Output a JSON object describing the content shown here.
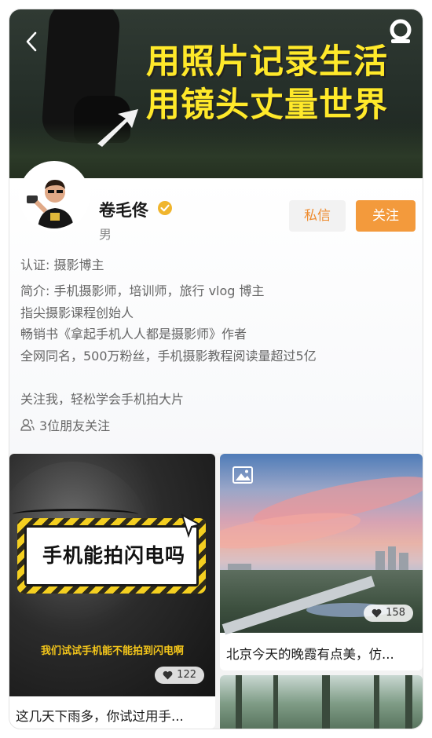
{
  "cover": {
    "headline_line1": "用照片记录生活",
    "headline_line2": "用镜头丈量世界"
  },
  "profile": {
    "name": "卷毛佟",
    "gender": "男",
    "message_label": "私信",
    "follow_label": "关注",
    "certification": "认证: 摄影博主",
    "bio_lines": [
      "简介: 手机摄影师，培训师，旅行 vlog 博主",
      "指尖摄影课程创始人",
      "畅销书《拿起手机人人都是摄影师》作者",
      "全网同名，500万粉丝，手机摄影教程阅读量超过5亿",
      "关注我，轻松学会手机拍大片"
    ],
    "friends_following": "3位朋友关注"
  },
  "feed": [
    {
      "cover_text": "手机能拍闪电吗",
      "cover_subtitle": "我们试试手机能不能拍到闪电啊",
      "likes": "122",
      "title": "这几天下雨多，你试过用手..."
    },
    {
      "likes": "158",
      "title": "北京今天的晚霞有点美，仿..."
    }
  ],
  "colors": {
    "accent_orange": "#f39a3c",
    "message_text": "#ee8b2e",
    "cover_headline": "#ffe92a",
    "verified_badge": "#f0b52d"
  }
}
